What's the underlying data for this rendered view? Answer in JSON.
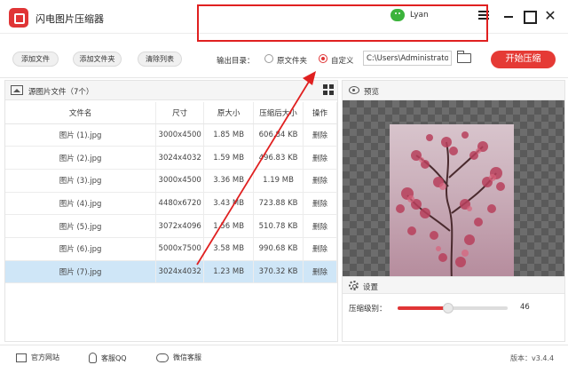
{
  "app": {
    "title": "闪电图片压缩器",
    "username": "Lyan"
  },
  "toolbar": {
    "add_file": "添加文件",
    "add_folder": "添加文件夹",
    "clear_list": "清除列表",
    "output_label": "输出目录：",
    "option_original": "原文件夹",
    "option_custom": "自定义",
    "selected_option": "自定义",
    "output_path": "C:\\Users\\Administrator",
    "start": "开始压缩"
  },
  "file_panel": {
    "title": "源图片文件（7个）",
    "columns": [
      "文件名",
      "尺寸",
      "原大小",
      "压缩后大小",
      "操作"
    ],
    "rows": [
      {
        "name": "图片 (1).jpg",
        "size": "3000x4500",
        "orig": "1.85 MB",
        "compressed": "606.84 KB",
        "action": "删除"
      },
      {
        "name": "图片 (2).jpg",
        "size": "3024x4032",
        "orig": "1.59 MB",
        "compressed": "496.83 KB",
        "action": "删除"
      },
      {
        "name": "图片 (3).jpg",
        "size": "3000x4500",
        "orig": "3.36 MB",
        "compressed": "1.19 MB",
        "action": "删除"
      },
      {
        "name": "图片 (4).jpg",
        "size": "4480x6720",
        "orig": "3.43 MB",
        "compressed": "723.88 KB",
        "action": "删除"
      },
      {
        "name": "图片 (5).jpg",
        "size": "3072x4096",
        "orig": "1.56 MB",
        "compressed": "510.78 KB",
        "action": "删除"
      },
      {
        "name": "图片 (6).jpg",
        "size": "5000x7500",
        "orig": "3.58 MB",
        "compressed": "990.68 KB",
        "action": "删除"
      },
      {
        "name": "图片 (7).jpg",
        "size": "3024x4032",
        "orig": "1.23 MB",
        "compressed": "370.32 KB",
        "action": "删除"
      }
    ],
    "selected_row": 6
  },
  "preview_panel": {
    "title": "预览"
  },
  "settings": {
    "title": "设置",
    "level_label": "压缩级别：",
    "level_value": "46",
    "level_fraction": 0.46
  },
  "footer": {
    "website": "官方网站",
    "qq": "客服QQ",
    "wechat": "微信客服",
    "version": "版本：v3.4.4"
  },
  "colors": {
    "accent": "#e53a35",
    "selected_row": "#cfe6f7",
    "annotation": "#e02020"
  }
}
